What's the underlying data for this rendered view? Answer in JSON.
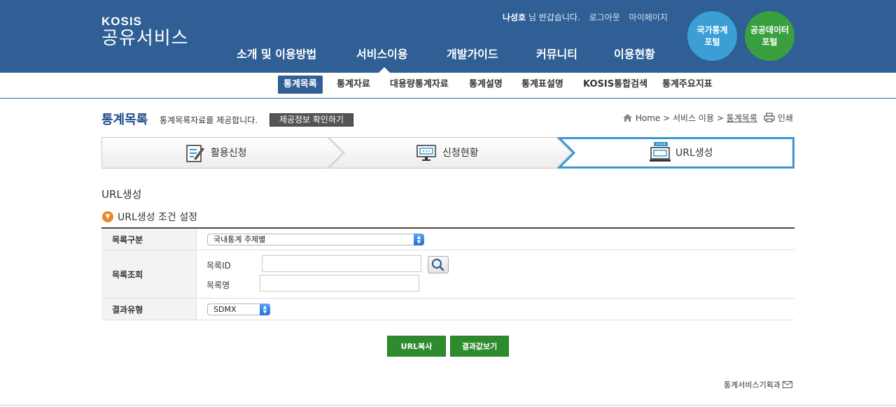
{
  "header": {
    "logo_top": "KOSIS",
    "logo_bottom": "공유서비스",
    "user_name": "나성호",
    "greeting": "님 반갑습니다.",
    "logout": "로그아웃",
    "mypage": "마이페이지",
    "nav": [
      "소개 및 이용방법",
      "서비스이용",
      "개발가이드",
      "커뮤니티",
      "이용현황"
    ],
    "portal1_line1": "국가통계",
    "portal1_line2": "포털",
    "portal2_line1": "공공데이터",
    "portal2_line2": "포털",
    "colors": {
      "header_bg": "#2f5f95",
      "portal1": "#3b9fd6",
      "portal2": "#3aa03f"
    }
  },
  "subnav": {
    "items": [
      "통계목록",
      "통계자료",
      "대용량통계자료",
      "통계설명",
      "통계표설명",
      "KOSIS통합검색",
      "통계주요지표"
    ],
    "active": "통계목록"
  },
  "page": {
    "title": "통계목록",
    "desc": "통계목록자료를 제공합니다.",
    "info_button": "제공정보 확인하기",
    "breadcrumb_home": "Home",
    "breadcrumb_sep": ">",
    "breadcrumb_mid": "서비스 이용",
    "breadcrumb_cur": "통계목록",
    "print": "인쇄"
  },
  "steps": {
    "s1": "활용신청",
    "s2": "신청현황",
    "s3": "URL생성",
    "active": "URL생성"
  },
  "section": {
    "title": "URL생성",
    "subtitle": "URL생성 조건 설정"
  },
  "form": {
    "row1_label": "목록구분",
    "row1_select": "국내통계 주제별",
    "row2_label": "목록조회",
    "id_label": "목록ID",
    "id_value": "",
    "name_label": "목록명",
    "name_value": "",
    "row3_label": "결과유형",
    "row3_select": "SDMX"
  },
  "buttons": {
    "copy_url": "URL복사",
    "view_result": "결과값보기"
  },
  "footer": {
    "dept": "통계서비스기획과"
  }
}
